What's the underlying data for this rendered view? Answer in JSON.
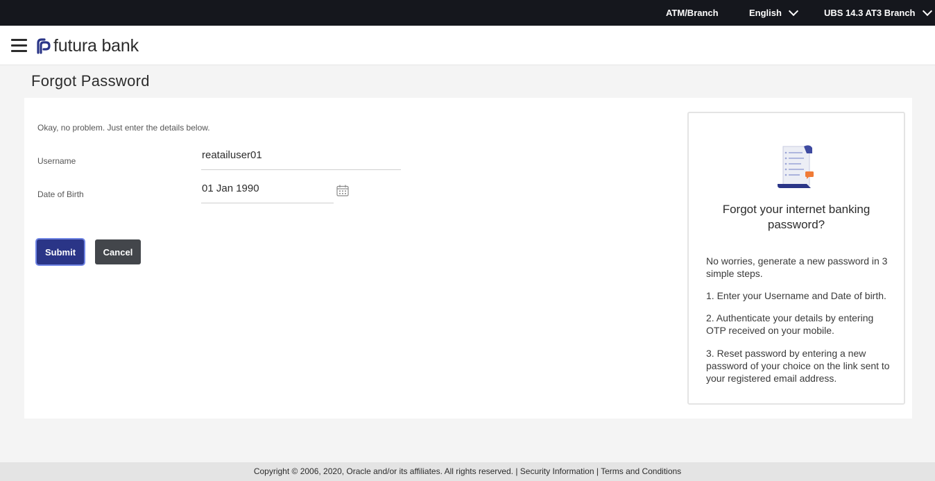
{
  "topbar": {
    "atm_branch": "ATM/Branch",
    "language": "English",
    "entity": "UBS 14.3 AT3 Branch"
  },
  "header": {
    "brand": "futura bank"
  },
  "page": {
    "title": "Forgot Password"
  },
  "form": {
    "intro": "Okay, no problem. Just enter the details below.",
    "username_label": "Username",
    "username_value": "reatailuser01",
    "dob_label": "Date of Birth",
    "dob_value": "01 Jan 1990",
    "submit_label": "Submit",
    "cancel_label": "Cancel"
  },
  "info": {
    "title": "Forgot your internet banking password?",
    "intro": "No worries, generate a new password in 3 simple steps.",
    "step1": "1. Enter your Username and Date of birth.",
    "step2": "2. Authenticate your details by entering OTP received on your mobile.",
    "step3": "3. Reset password by entering a new password of your choice on the link sent to your registered email address."
  },
  "footer": {
    "copyright": "Copyright © 2006, 2020, Oracle and/or its affiliates. All rights reserved.",
    "separator": "|",
    "security_link": "Security Information",
    "terms_link": "Terms and Conditions"
  },
  "colors": {
    "topbar_bg": "#15171d",
    "submit_bg": "#2a3587",
    "cancel_bg": "#43464b",
    "brand_accent": "#2a3587",
    "illustration_accent": "#f07b36"
  }
}
